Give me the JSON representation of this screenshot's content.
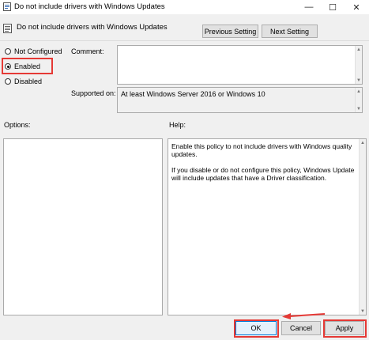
{
  "window": {
    "title": "Do not include drivers with Windows Updates",
    "minimize_glyph": "—",
    "maximize_glyph": "☐",
    "close_glyph": "✕"
  },
  "header": {
    "policy_name": "Do not include drivers with Windows Updates",
    "previous_label": "Previous Setting",
    "next_label": "Next Setting"
  },
  "state": {
    "options": [
      {
        "label": "Not Configured",
        "checked": false
      },
      {
        "label": "Enabled",
        "checked": true
      },
      {
        "label": "Disabled",
        "checked": false
      }
    ]
  },
  "comment": {
    "label": "Comment:",
    "value": ""
  },
  "supported": {
    "label": "Supported on:",
    "value": "At least Windows Server 2016 or Windows 10"
  },
  "panes": {
    "options_label": "Options:",
    "help_label": "Help:"
  },
  "help": {
    "paragraphs": [
      "Enable this policy to not include drivers with Windows quality updates.",
      "If you disable or do not configure this policy, Windows Update will include updates that have a Driver classification."
    ]
  },
  "footer": {
    "ok_label": "OK",
    "cancel_label": "Cancel",
    "apply_label": "Apply"
  },
  "annotations": {
    "highlight_color": "#e53935"
  }
}
